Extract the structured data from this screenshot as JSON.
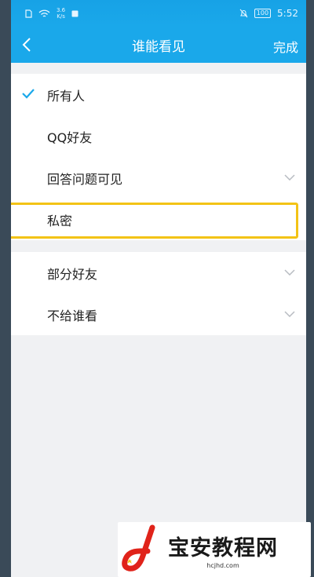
{
  "status_bar": {
    "network_speed_value": "3.6",
    "network_speed_unit": "K/s",
    "battery": "100",
    "time": "5:52"
  },
  "header": {
    "title": "谁能看见",
    "done_label": "完成"
  },
  "options": [
    {
      "label": "所有人",
      "selected": true
    },
    {
      "label": "QQ好友",
      "selected": false
    },
    {
      "label": "回答问题可见",
      "selected": false,
      "expandable": true
    },
    {
      "label": "私密",
      "selected": false,
      "highlighted": true
    }
  ],
  "options_group2": [
    {
      "label": "部分好友",
      "expandable": true
    },
    {
      "label": "不给谁看",
      "expandable": true
    }
  ],
  "watermark": {
    "name": "宝安教程网",
    "url": "hcjhd.com"
  },
  "colors": {
    "accent": "#1aa8ea",
    "highlight": "#f3c316",
    "watermark_red": "#e0231a"
  }
}
